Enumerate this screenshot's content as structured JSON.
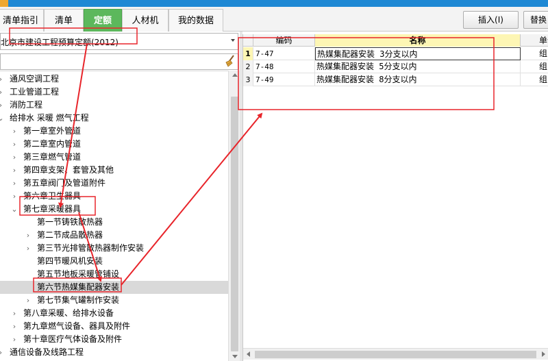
{
  "tabs": [
    "清单指引",
    "清单",
    "定额",
    "人材机",
    "我的数据"
  ],
  "active_tab": "定额",
  "toolbar": {
    "insert_label": "插入(I)",
    "replace_label": "替换"
  },
  "quota_library": "北京市建设工程预算定额(2012)",
  "tree": [
    {
      "label": "通风空调工程",
      "level": 0,
      "expander": "collapsed"
    },
    {
      "label": "工业管道工程",
      "level": 0,
      "expander": "collapsed"
    },
    {
      "label": "消防工程",
      "level": 0,
      "expander": "collapsed"
    },
    {
      "label": "给排水 采暖 燃气工程",
      "level": 0,
      "expander": "expanded"
    },
    {
      "label": "第一章室外管道",
      "level": 1,
      "expander": "collapsed"
    },
    {
      "label": "第二章室内管道",
      "level": 1,
      "expander": "collapsed"
    },
    {
      "label": "第三章燃气管道",
      "level": 1,
      "expander": "collapsed"
    },
    {
      "label": "第四章支架、套管及其他",
      "level": 1,
      "expander": "collapsed"
    },
    {
      "label": "第五章阀门及管道附件",
      "level": 1,
      "expander": "collapsed"
    },
    {
      "label": "第六章卫生器具",
      "level": 1,
      "expander": "collapsed"
    },
    {
      "label": "第七章采暖器具",
      "level": 1,
      "expander": "expanded"
    },
    {
      "label": "第一节铸铁散热器",
      "level": 2,
      "expander": "none"
    },
    {
      "label": "第二节成品散热器",
      "level": 2,
      "expander": "collapsed"
    },
    {
      "label": "第三节光排管散热器制作安装",
      "level": 2,
      "expander": "collapsed"
    },
    {
      "label": "第四节暖风机安装",
      "level": 2,
      "expander": "none"
    },
    {
      "label": "第五节地板采暖管铺设",
      "level": 2,
      "expander": "none"
    },
    {
      "label": "第六节热媒集配器安装",
      "level": 2,
      "expander": "none",
      "selected": true
    },
    {
      "label": "第七节集气罐制作安装",
      "level": 2,
      "expander": "collapsed"
    },
    {
      "label": "第八章采暖、给排水设备",
      "level": 1,
      "expander": "collapsed"
    },
    {
      "label": "第九章燃气设备、器具及附件",
      "level": 1,
      "expander": "collapsed"
    },
    {
      "label": "第十章医疗气体设备及附件",
      "level": 1,
      "expander": "collapsed"
    },
    {
      "label": "通信设备及线路工程",
      "level": 0,
      "expander": "collapsed"
    }
  ],
  "grid": {
    "columns": [
      "编码",
      "名称",
      "单位"
    ],
    "rows": [
      {
        "num": "1",
        "code": "7-47",
        "name": "热媒集配器安装 3分支以内",
        "unit": "组"
      },
      {
        "num": "2",
        "code": "7-48",
        "name": "热媒集配器安装 5分支以内",
        "unit": "组"
      },
      {
        "num": "3",
        "code": "7-49",
        "name": "热媒集配器安装 8分支以内",
        "unit": "组"
      }
    ]
  },
  "colors": {
    "active_tab": "#5cb85c",
    "annotation": "#e8242a",
    "header_highlight": "#fdf6b4",
    "selected_row": "#d9d9d9"
  },
  "icons": [
    "broom-icon",
    "chevron-down-icon",
    "chevron-right-icon"
  ]
}
